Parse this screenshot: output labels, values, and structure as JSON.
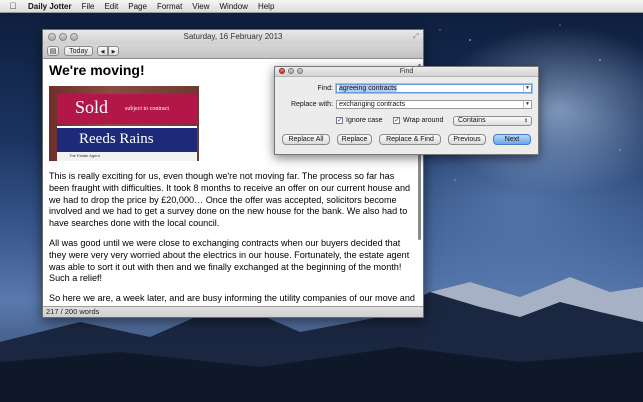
{
  "menubar": {
    "app_name": "Daily Jotter",
    "items": [
      "File",
      "Edit",
      "Page",
      "Format",
      "View",
      "Window",
      "Help"
    ]
  },
  "window": {
    "title": "Saturday, 16 February 2013",
    "toolbar": {
      "today_label": "Today",
      "prev": "◀",
      "next": "▶"
    },
    "heading": "We're moving!",
    "photo": {
      "sold_text": "Sold",
      "subject_text": "subject to contract",
      "agent_name": "Reeds Rains",
      "agent_sub": "The Estate Agent"
    },
    "paragraphs": [
      "This is really exciting for us, even though we're not moving far. The process so far has been fraught with difficulties. It took 8 months to receive an offer on our current house and we had to drop the price by £20,000… Once the offer was accepted, solicitors become involved and we had to get a survey done on the new house for the bank. We also had to have searches done with the local council.",
      "All was good until we were close to exchanging contracts when our buyers decided that they were very very worried about the electrics in our house. Fortunately, the estate agent was able to sort it out with then and we finally exchanged at the beginning of the month! Such a relief!",
      "So here we are, a week later, and are busy informing the utility companies of our move and"
    ],
    "status": "217 / 200 words"
  },
  "find_panel": {
    "title": "Find",
    "find_label": "Find:",
    "find_value": "agreeing contracts",
    "replace_label": "Replace with:",
    "replace_value": "exchanging contracts",
    "ignore_case_label": "Ignore case",
    "ignore_case": true,
    "wrap_around_label": "Wrap around",
    "wrap_around": true,
    "match_mode": "Contains",
    "buttons": {
      "replace_all": "Replace All",
      "replace": "Replace",
      "replace_find": "Replace & Find",
      "previous": "Previous",
      "next": "Next"
    }
  },
  "colors": {
    "sold_red": "#b3174a",
    "agent_blue": "#1d2a7a",
    "default_button": "#6ea5ea"
  }
}
